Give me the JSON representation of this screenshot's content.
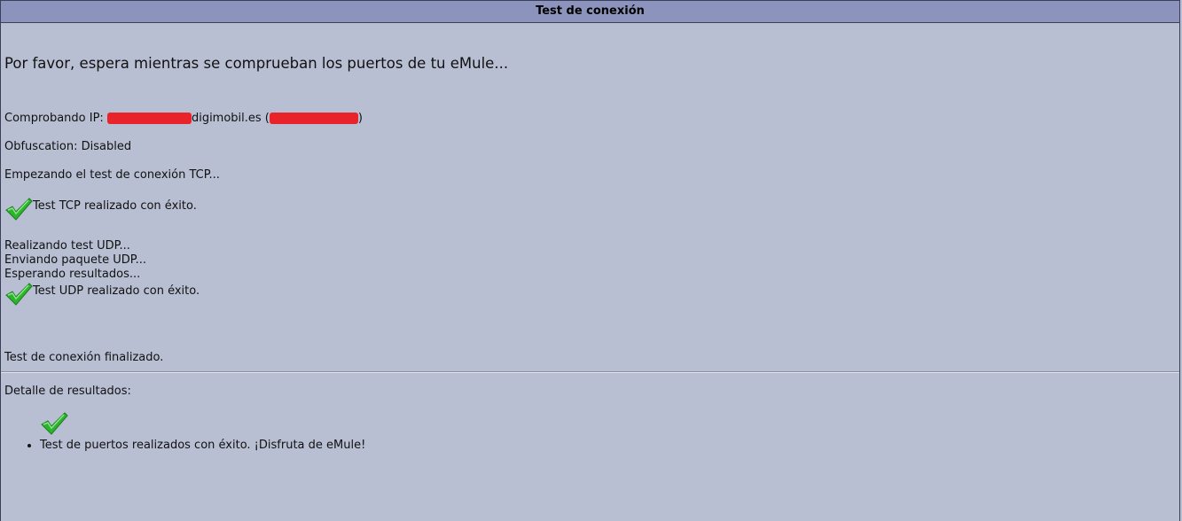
{
  "window": {
    "title": "Test de conexión"
  },
  "main": {
    "headline": "Por favor, espera mientras se comprueban los puertos de tu eMule...",
    "ip_label": "Comprobando IP: ",
    "ip_host_suffix": "digimobil.es (",
    "ip_close": ")",
    "obfuscation": "Obfuscation: Disabled",
    "tcp_start": "Empezando el test de conexión TCP...",
    "tcp_result": "Test TCP realizado con éxito.",
    "udp_lines": [
      "Realizando test UDP...",
      "Enviando paquete UDP...",
      "Esperando resultados..."
    ],
    "udp_result": "Test UDP realizado con éxito.",
    "finished": "Test de conexión finalizado.",
    "details_label": "Detalle de resultados:",
    "details_items": [
      "Test de puertos realizados con éxito. ¡Disfruta de eMule!"
    ]
  },
  "colors": {
    "background": "#b8bfd3",
    "titlebar": "#8c94bd",
    "redaction": "#e8232a",
    "check": "#2db42d"
  },
  "icons": {
    "success": "checkmark-icon"
  }
}
